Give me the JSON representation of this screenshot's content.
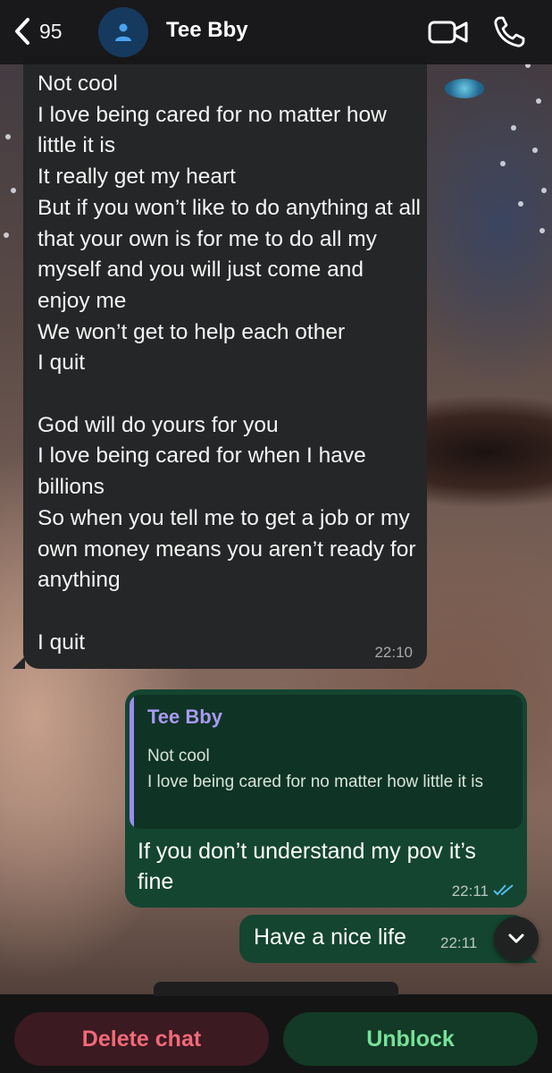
{
  "header": {
    "back_count": "95",
    "contact_name": "Tee Bby",
    "icons": [
      "chevron-left-icon",
      "person-icon",
      "video-call-icon",
      "phone-icon"
    ]
  },
  "messages": {
    "incoming": {
      "text": "Not cool\nI love being cared for no matter how little it is\nIt really get my heart\nBut if you won’t like to do anything at all that your own is for me to do all my myself and you will just come and enjoy me\nWe won’t get to help each other\nI quit\n\nGod will do yours for you\nI love being cared for when I have billions\nSo when you tell me to get a job or my own money means you aren’t ready for anything\n\nI quit",
      "time": "22:10"
    },
    "outgoing_reply": {
      "quote_name": "Tee Bby",
      "quote_text": "Not cool\nI love being cared for no matter how little it is",
      "text": "If you don’t understand my pov it’s fine",
      "time": "22:11",
      "status": "read"
    },
    "outgoing_last": {
      "text": "Have a nice life",
      "time": "22:11"
    }
  },
  "footer": {
    "delete_label": "Delete chat",
    "unblock_label": "Unblock"
  },
  "colors": {
    "incoming_bubble": "#252627",
    "outgoing_bubble": "#144530",
    "quote_accent": "#9b8cf0",
    "delete_text": "#f16a78",
    "unblock_text": "#77e09a",
    "read_ticks": "#53bdeb"
  }
}
